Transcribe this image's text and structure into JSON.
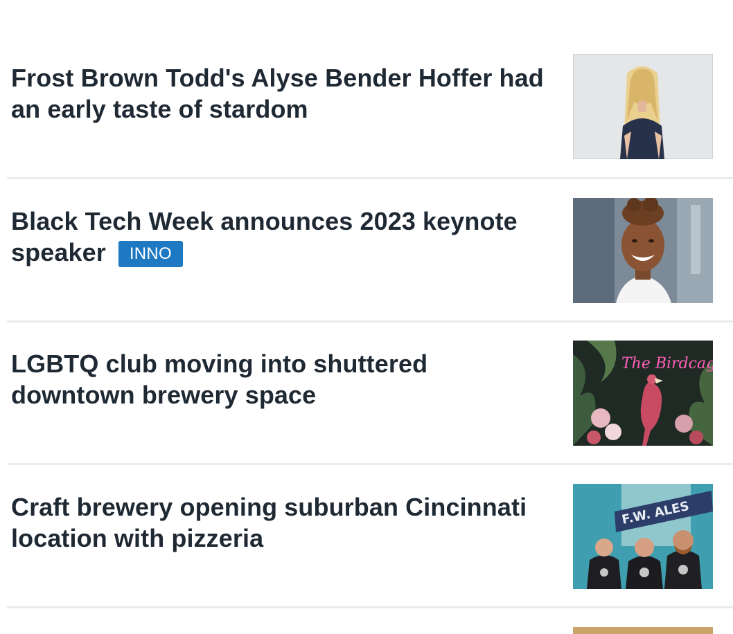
{
  "stories": [
    {
      "headline": "Frost Brown Todd's Alyse Bender Hoffer had an early taste of stardom",
      "badge": "",
      "thumbnail": "portrait-woman-blonde-photo"
    },
    {
      "headline": "Black Tech Week announces 2023 keynote speaker",
      "badge": "INNO",
      "thumbnail": "portrait-woman-smiling-photo"
    },
    {
      "headline": "LGBTQ club moving into shuttered downtown brewery space",
      "badge": "",
      "thumbnail": "neon-sign-flamingo-mural-photo",
      "thumbnail_text": "The Birdcage"
    },
    {
      "headline": "Craft brewery opening suburban Cincinnati location with pizzeria",
      "badge": "",
      "thumbnail": "brewery-owners-group-photo",
      "thumbnail_text": "F.W. ALES"
    }
  ],
  "colors": {
    "headline": "#1f2933",
    "badge_bg": "#1e79c2",
    "divider": "#e8ecef"
  }
}
